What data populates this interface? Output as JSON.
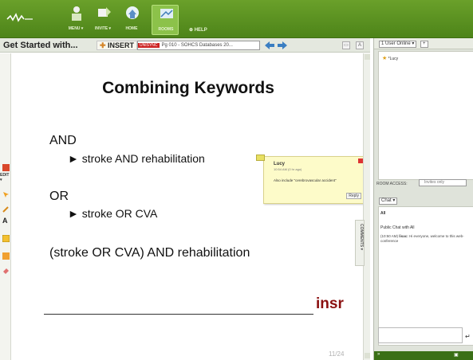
{
  "toolbar": {
    "buttons": [
      {
        "label": "MENU ▾"
      },
      {
        "label": "INVITE ▾"
      },
      {
        "label": "HOME"
      },
      {
        "label": "ROOMS"
      }
    ],
    "help_label": "⊕ HELP"
  },
  "presentation": {
    "title": "Get Started with...",
    "insert_label": "INSERT",
    "document_tag": "UNISYNC",
    "document_value": "Pg 010 - SOHCS Databases 20...",
    "edit_label": "EDIT ▾",
    "comments_tab_label": "COMMENTS ▾"
  },
  "slide": {
    "title": "Combining Keywords",
    "and_heading": "AND",
    "and_bullet": "► stroke AND rehabilitation",
    "or_heading": "OR",
    "or_bullet": "► stroke OR CVA",
    "combined": "(stroke OR CVA) AND rehabilitation",
    "footer_text": "insr",
    "page_number": "11/24"
  },
  "comment": {
    "author": "Lucy",
    "time": "10:54 AM (0 hr ago)",
    "body": "Also include \"cerebrovascular accident\"",
    "reply_label": "Reply"
  },
  "users": {
    "header": "1 User Online ▾",
    "list": [
      {
        "name": "*Lucy"
      }
    ],
    "room_access_label": "ROOM ACCESS:",
    "room_access_value": "Invites only"
  },
  "chat": {
    "header": "Chat ▾",
    "to_label": "All",
    "public_label": "Public Chat with All",
    "message_time": "(10:50 AM)",
    "message_author": "lisac:",
    "message_text": "Hi everyone, welcome to this web-conference"
  },
  "colors": {
    "toolbar_green": "#5a9121",
    "slide_accent": "#8b1010",
    "comment_bg": "#fdfbc9"
  }
}
